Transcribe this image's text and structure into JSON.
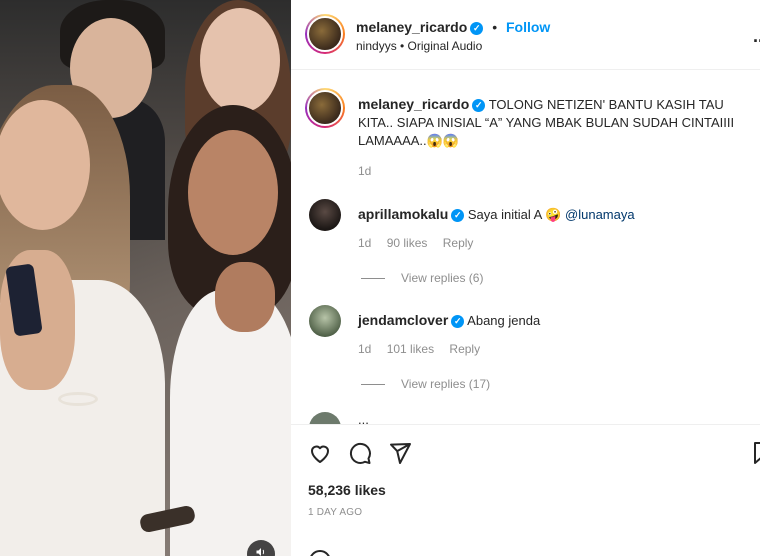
{
  "post": {
    "username": "melaney_ricardo",
    "follow_label": "Follow",
    "separator": "•",
    "audio": "nindyys • Original Audio",
    "more_label": "...",
    "caption_username": "melaney_ricardo",
    "caption_text": "TOLONG NETIZEN' BANTU KASIH TAU KITA.. SIAPA INISIAL “A” YANG MBAK BULAN SUDAH CINTAIIII LAMAAAA..😱😱",
    "caption_time": "1d"
  },
  "comments": [
    {
      "username": "aprillamokalu",
      "text": "Saya initial A 🤪",
      "mention": "@lunamaya",
      "time": "1d",
      "likes": "90 likes",
      "reply": "Reply",
      "view_replies": "View replies (6)"
    },
    {
      "username": "jendamclover",
      "text": "Abang jenda",
      "mention": "",
      "time": "1d",
      "likes": "101 likes",
      "reply": "Reply",
      "view_replies": "View replies (17)"
    }
  ],
  "partial_comment": "...",
  "footer": {
    "likes": "58,236 likes",
    "date": "1 DAY AGO",
    "icons": [
      "heart-icon",
      "comment-icon",
      "share-icon",
      "bookmark-icon",
      "emoji-icon"
    ]
  },
  "media": {
    "icons": [
      "speaker-icon"
    ]
  },
  "colors": {
    "accent": "#0095f6",
    "muted": "#8e8e8e",
    "text": "#262626",
    "border": "#efefef"
  }
}
